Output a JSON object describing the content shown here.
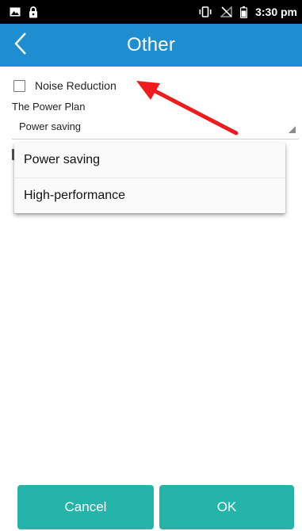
{
  "status_bar": {
    "time": "3:30 pm",
    "left_icons": [
      "image-icon",
      "lock-icon"
    ],
    "right_icons": [
      "vibrate-icon",
      "no-signal-icon",
      "battery-icon"
    ]
  },
  "app_bar": {
    "title": "Other",
    "back_icon": "chevron-left-icon",
    "background": "#1f8ed1"
  },
  "settings": {
    "noise_reduction": {
      "label": "Noise Reduction",
      "checked": false
    },
    "power_plan": {
      "label": "The Power Plan",
      "selected": "Power saving",
      "options": [
        "Power saving",
        "High-performance"
      ]
    }
  },
  "footer": {
    "cancel_label": "Cancel",
    "ok_label": "OK",
    "button_color": "#26b3aa"
  },
  "annotation": {
    "arrow_color": "#ee1c1c"
  }
}
